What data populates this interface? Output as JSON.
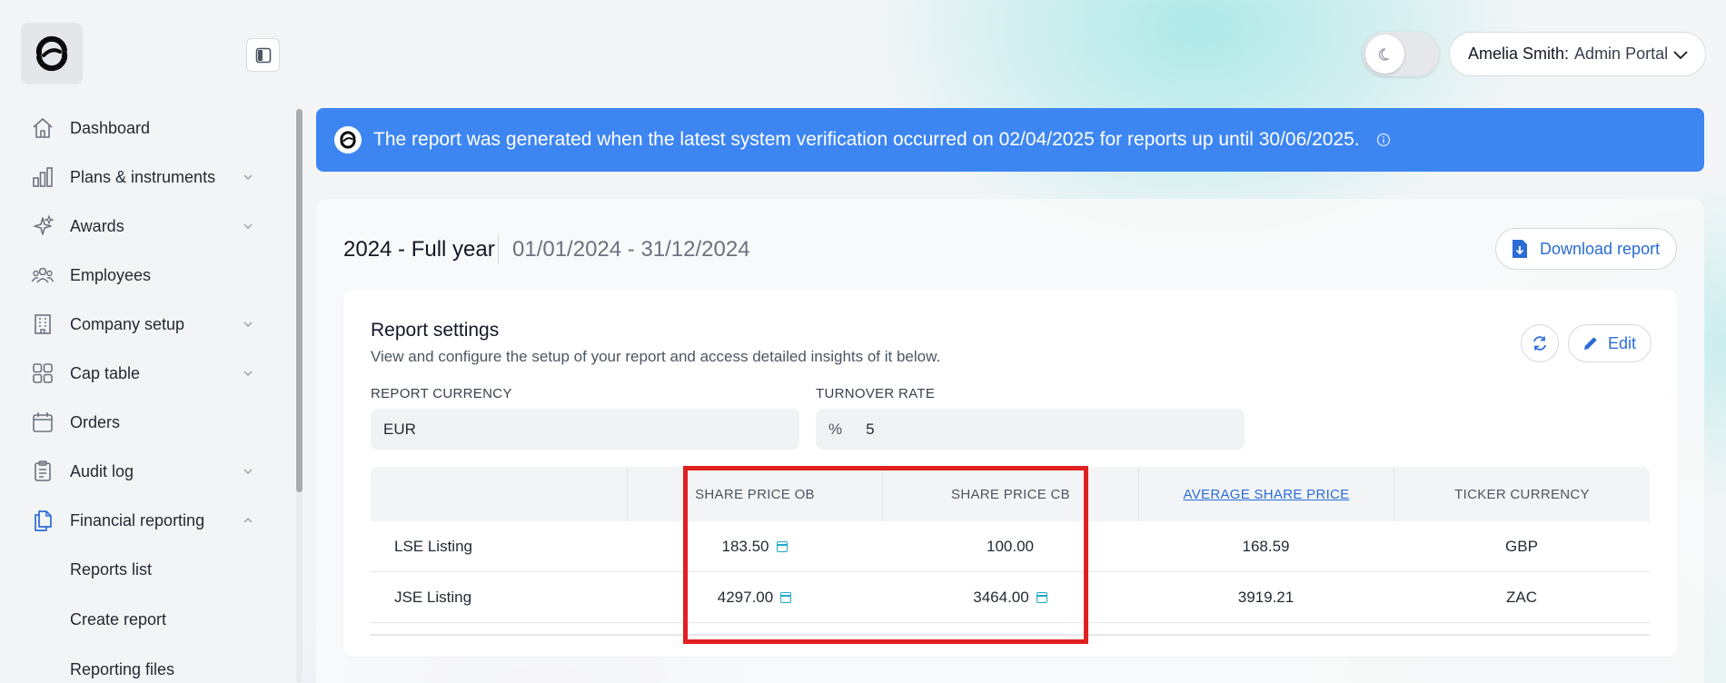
{
  "sidebar": {
    "items": [
      {
        "label": "Dashboard",
        "icon": "home-icon",
        "has_chevron": false
      },
      {
        "label": "Plans & instruments",
        "icon": "bar-chart-icon",
        "has_chevron": true
      },
      {
        "label": "Awards",
        "icon": "sparkles-icon",
        "has_chevron": true
      },
      {
        "label": "Employees",
        "icon": "users-icon",
        "has_chevron": false
      },
      {
        "label": "Company setup",
        "icon": "building-icon",
        "has_chevron": true
      },
      {
        "label": "Cap table",
        "icon": "grid-icon",
        "has_chevron": true
      },
      {
        "label": "Orders",
        "icon": "calendar-icon",
        "has_chevron": false
      },
      {
        "label": "Audit log",
        "icon": "clipboard-icon",
        "has_chevron": true
      },
      {
        "label": "Financial reporting",
        "icon": "documents-icon",
        "has_chevron": true,
        "expanded": true
      }
    ],
    "subitems": [
      "Reports list",
      "Create report",
      "Reporting files"
    ]
  },
  "header": {
    "user_name": "Amelia Smith:",
    "portal": "Admin Portal"
  },
  "banner": {
    "text": "The report was generated when the latest system verification occurred on 02/04/2025 for reports up until 30/06/2025."
  },
  "report": {
    "period_title": "2024 - Full year",
    "period_range": "01/01/2024 - 31/12/2024",
    "download_label": "Download report",
    "settings_title": "Report settings",
    "settings_desc": "View and configure the setup of your report and access detailed insights of it below.",
    "edit_label": "Edit",
    "currency_label": "REPORT CURRENCY",
    "currency_value": "EUR",
    "turnover_label": "TURNOVER RATE",
    "turnover_prefix": "%",
    "turnover_value": "5"
  },
  "table": {
    "headers": [
      "",
      "SHARE PRICE OB",
      "SHARE PRICE CB",
      "AVERAGE SHARE PRICE",
      "TICKER CURRENCY"
    ],
    "rows": [
      {
        "name": "LSE Listing",
        "ob": "183.50",
        "cb": "100.00",
        "avg": "168.59",
        "currency": "GBP"
      },
      {
        "name": "JSE Listing",
        "ob": "4297.00",
        "cb": "3464.00",
        "avg": "3919.21",
        "currency": "ZAC"
      }
    ]
  },
  "colors": {
    "accent": "#3d86f2",
    "link": "#2b6cd6",
    "highlight": "#e0201f"
  }
}
